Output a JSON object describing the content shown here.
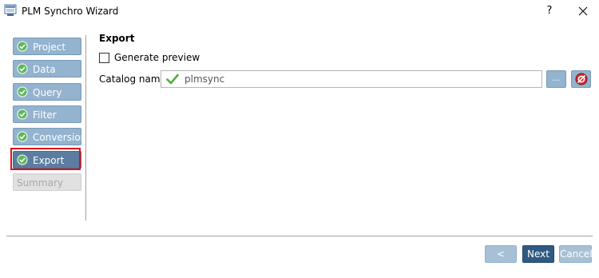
{
  "window": {
    "title": "PLM Synchro Wizard",
    "help_label": "?",
    "close_label": "✕"
  },
  "steps": [
    {
      "label": "Project",
      "state": "done"
    },
    {
      "label": "Data source",
      "state": "done"
    },
    {
      "label": "Query",
      "state": "done"
    },
    {
      "label": "Filter",
      "state": "done"
    },
    {
      "label": "Conversion",
      "state": "done"
    },
    {
      "label": "Export",
      "state": "active"
    },
    {
      "label": "Summary",
      "state": "disabled"
    }
  ],
  "main": {
    "section_title": "Export",
    "generate_preview": {
      "label": "Generate preview",
      "checked": false
    },
    "catalog": {
      "label": "Catalog name:",
      "value": "plmsync"
    },
    "browse_label": "..."
  },
  "footer": {
    "back_label": "< Back",
    "next_label": "Next >",
    "cancel_label": "Cancel"
  },
  "colors": {
    "step_done": "#93b3cf",
    "step_active": "#5b7d9f",
    "highlight_frame": "#e0101a",
    "next_button": "#2e5a82"
  }
}
